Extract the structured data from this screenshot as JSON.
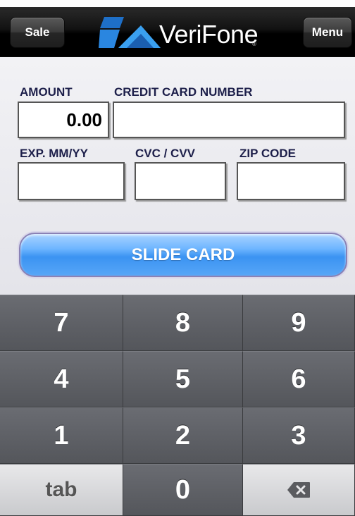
{
  "header": {
    "left_button": "Sale",
    "brand": "VeriFone",
    "right_button": "Menu"
  },
  "form": {
    "amount_label": "AMOUNT",
    "amount_value": "0.00",
    "card_label": "CREDIT CARD NUMBER",
    "card_value": "",
    "exp_label": "EXP. MM/YY",
    "exp_value": "",
    "cvc_label": "CVC / CVV",
    "cvc_value": "",
    "zip_label": "ZIP CODE",
    "zip_value": "",
    "slide_button": "SLIDE CARD"
  },
  "keypad": {
    "keys": [
      "7",
      "8",
      "9",
      "4",
      "5",
      "6",
      "1",
      "2",
      "3",
      "tab",
      "0"
    ],
    "delete_icon": "backspace-icon"
  },
  "colors": {
    "label_text": "#1d1f4a",
    "slide_button": "#4a9ff5",
    "key_dark": "#5f6166",
    "key_light": "#d8d9dc",
    "logo_blue": "#2a7fd6"
  }
}
